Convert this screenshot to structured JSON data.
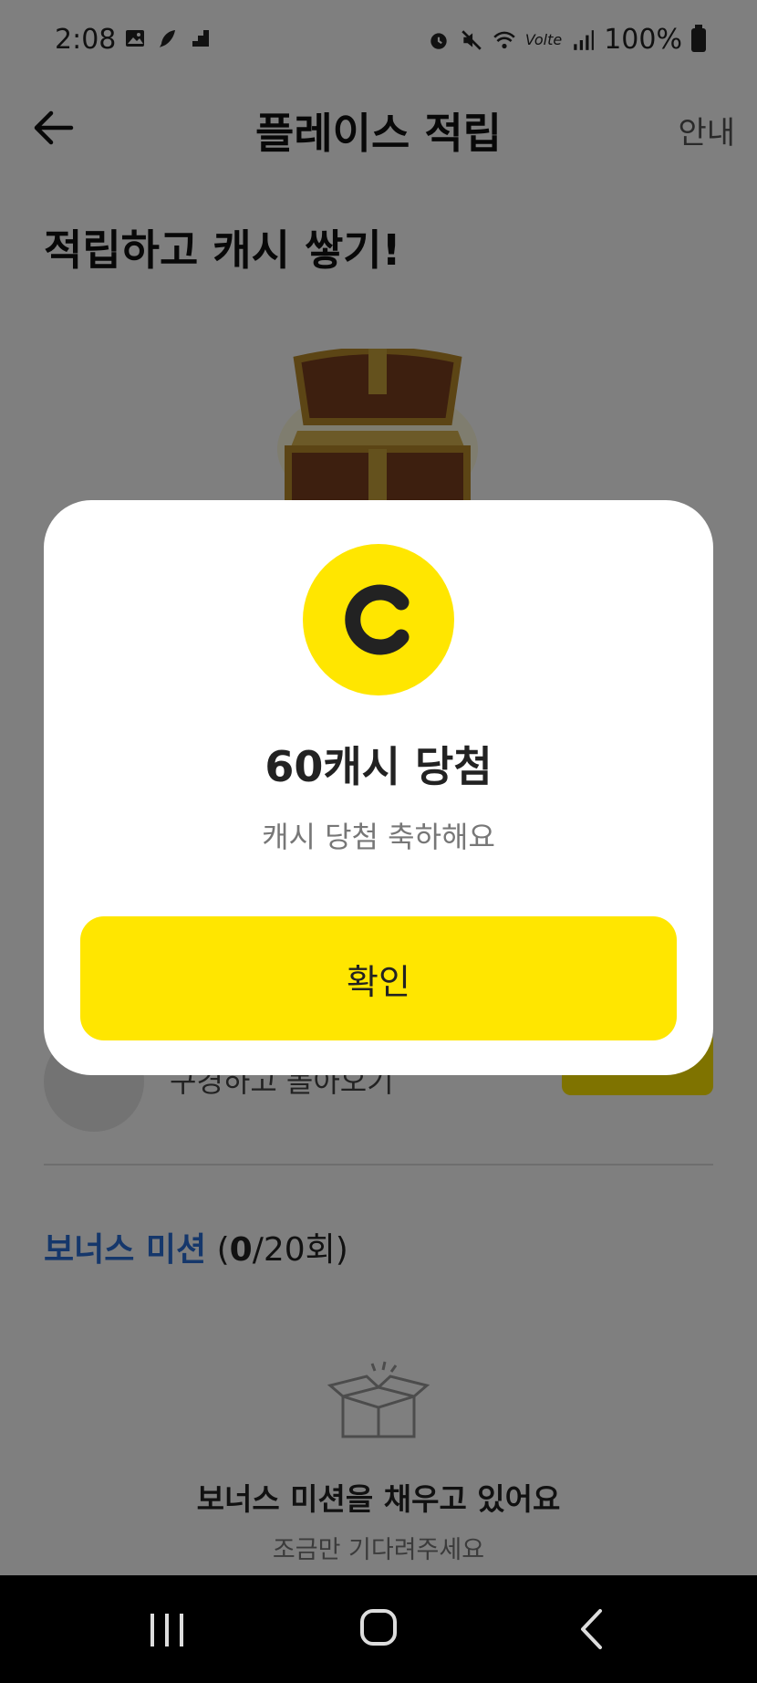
{
  "status_bar": {
    "time": "2:08",
    "left_icons": [
      "image-icon",
      "feather-icon",
      "stairs-icon"
    ],
    "right_icons": [
      "alarm-icon",
      "mute-icon",
      "wifi-icon",
      "volte-icon",
      "signal-icon",
      "battery-icon"
    ],
    "volte_label": "Volte",
    "battery": "100%"
  },
  "header": {
    "title": "플레이스 적립",
    "info_link": "안내",
    "back_icon": "arrow-left-icon"
  },
  "hero": {
    "heading": "적립하고 캐시 쌓기!",
    "image": "treasure-chest"
  },
  "background_row": {
    "label": "구경하고 돌아오기"
  },
  "bonus": {
    "title": "보너스 미션",
    "count_open": "(",
    "count_done": "0",
    "count_total": "/20회)",
    "empty_title": "보너스 미션을 채우고 있어요",
    "empty_subtitle": "조금만 기다려주세요"
  },
  "modal": {
    "coin_letter": "C",
    "title": "60캐시 당첨",
    "subtitle": "캐시 당첨 축하해요",
    "confirm_label": "확인"
  },
  "colors": {
    "accent_yellow": "#ffe600",
    "bonus_blue": "#2b6fd6",
    "dim_overlay": "rgba(0,0,0,0.5)"
  }
}
